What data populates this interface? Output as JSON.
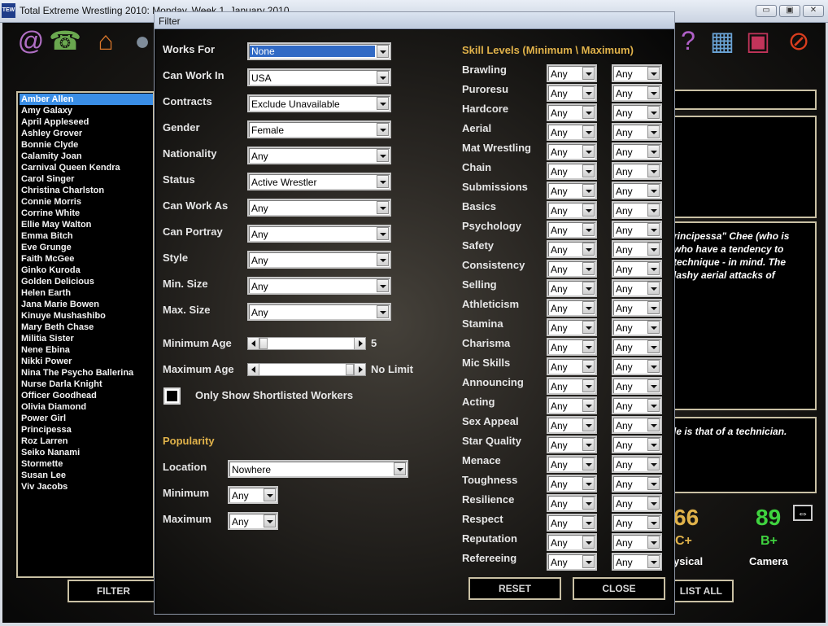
{
  "main_window": {
    "title": "Total Extreme Wrestling 2010: Monday, Week 1, January 2010",
    "app_icon": "TEW",
    "buttons": {
      "minimize": "▭",
      "maximize": "▣",
      "close": "✕"
    }
  },
  "toolbar_icons_left": [
    {
      "name": "at-icon",
      "glyph": "@",
      "color": "#b06fc4"
    },
    {
      "name": "phone-icon",
      "glyph": "☎",
      "color": "#6aa84f"
    },
    {
      "name": "home-icon",
      "glyph": "⌂",
      "color": "#d9772b"
    },
    {
      "name": "person-icon",
      "glyph": "●",
      "color": "#7f8c9a"
    }
  ],
  "toolbar_icons_right": [
    {
      "name": "help-icon",
      "glyph": "?",
      "color": "#b060c8"
    },
    {
      "name": "save-disk-icon",
      "glyph": "▦",
      "color": "#6aa3d5"
    },
    {
      "name": "floppy-icon",
      "glyph": "▣",
      "color": "#c2345a"
    },
    {
      "name": "stop-icon",
      "glyph": "⊘",
      "color": "#d93d1e"
    }
  ],
  "worker_list": {
    "selected": "Amber Allen",
    "items": [
      "Amber Allen",
      "Amy Galaxy",
      "April Appleseed",
      "Ashley Grover",
      "Bonnie Clyde",
      "Calamity Joan",
      "Carnival Queen Kendra",
      "Carol Singer",
      "Christina Charlston",
      "Connie Morris",
      "Corrine White",
      "Ellie May Walton",
      "Emma Bitch",
      "Eve Grunge",
      "Faith McGee",
      "Ginko Kuroda",
      "Golden Delicious",
      "Helen Earth",
      "Jana Marie Bowen",
      "Kinuye Mushashibo",
      "Mary Beth Chase",
      "Militia Sister",
      "Nene Ebina",
      "Nikki Power",
      "Nina The Psycho Ballerina",
      "Nurse Darla Knight",
      "Officer Goodhead",
      "Olivia Diamond",
      "Power Girl",
      "Principessa",
      "Roz Larren",
      "Seiko Nanami",
      "Stormette",
      "Susan Lee",
      "Viv Jacobs"
    ]
  },
  "bottom_buttons": {
    "filter": "FILTER",
    "list_all": "LIST ALL"
  },
  "right_panel": {
    "bio_lines": [
      "rincipessa\" Chee (who is",
      "who have a tendency to",
      " technique - in mind. The",
      "lashy aerial attacks of"
    ],
    "style_line": "le is that of a technician.",
    "stats": [
      {
        "value": "66",
        "grade": "C+",
        "label": "ysical",
        "color": "#e0b24a"
      },
      {
        "value": "89",
        "grade": "B+",
        "label": "Camera",
        "color": "#3fd33f"
      }
    ],
    "swap_icon": "⇔"
  },
  "filter_dialog": {
    "title": "Filter",
    "fields": [
      {
        "label": "Works For",
        "value": "None",
        "selected": true
      },
      {
        "label": "Can Work In",
        "value": "USA"
      },
      {
        "label": "Contracts",
        "value": "Exclude Unavailable"
      },
      {
        "label": "Gender",
        "value": "Female"
      },
      {
        "label": "Nationality",
        "value": "Any"
      },
      {
        "label": "Status",
        "value": "Active Wrestler"
      },
      {
        "label": "Can Work As",
        "value": "Any"
      },
      {
        "label": "Can Portray",
        "value": "Any"
      },
      {
        "label": "Style",
        "value": "Any"
      },
      {
        "label": "Min. Size",
        "value": "Any"
      },
      {
        "label": "Max. Size",
        "value": "Any"
      }
    ],
    "min_age": {
      "label": "Minimum Age",
      "value": "5",
      "slider_fraction": 0.0
    },
    "max_age": {
      "label": "Maximum Age",
      "value": "No Limit",
      "slider_fraction": 1.0
    },
    "shortlist": {
      "label": "Only Show Shortlisted Workers",
      "checked": false
    },
    "popularity": {
      "heading": "Popularity",
      "location_label": "Location",
      "location_value": "Nowhere",
      "minimum_label": "Minimum",
      "minimum_value": "Any",
      "maximum_label": "Maximum",
      "maximum_value": "Any"
    },
    "skills": {
      "heading": "Skill Levels (Minimum \\ Maximum)",
      "items": [
        {
          "label": "Brawling",
          "min": "Any",
          "max": "Any"
        },
        {
          "label": "Puroresu",
          "min": "Any",
          "max": "Any"
        },
        {
          "label": "Hardcore",
          "min": "Any",
          "max": "Any"
        },
        {
          "label": "Aerial",
          "min": "Any",
          "max": "Any"
        },
        {
          "label": "Mat Wrestling",
          "min": "Any",
          "max": "Any"
        },
        {
          "label": "Chain",
          "min": "Any",
          "max": "Any"
        },
        {
          "label": "Submissions",
          "min": "Any",
          "max": "Any"
        },
        {
          "label": "Basics",
          "min": "Any",
          "max": "Any"
        },
        {
          "label": "Psychology",
          "min": "Any",
          "max": "Any"
        },
        {
          "label": "Safety",
          "min": "Any",
          "max": "Any"
        },
        {
          "label": "Consistency",
          "min": "Any",
          "max": "Any"
        },
        {
          "label": "Selling",
          "min": "Any",
          "max": "Any"
        },
        {
          "label": "Athleticism",
          "min": "Any",
          "max": "Any"
        },
        {
          "label": "Stamina",
          "min": "Any",
          "max": "Any"
        },
        {
          "label": "Charisma",
          "min": "Any",
          "max": "Any"
        },
        {
          "label": "Mic Skills",
          "min": "Any",
          "max": "Any"
        },
        {
          "label": "Announcing",
          "min": "Any",
          "max": "Any"
        },
        {
          "label": "Acting",
          "min": "Any",
          "max": "Any"
        },
        {
          "label": "Sex Appeal",
          "min": "Any",
          "max": "Any"
        },
        {
          "label": "Star Quality",
          "min": "Any",
          "max": "Any"
        },
        {
          "label": "Menace",
          "min": "Any",
          "max": "Any"
        },
        {
          "label": "Toughness",
          "min": "Any",
          "max": "Any"
        },
        {
          "label": "Resilience",
          "min": "Any",
          "max": "Any"
        },
        {
          "label": "Respect",
          "min": "Any",
          "max": "Any"
        },
        {
          "label": "Reputation",
          "min": "Any",
          "max": "Any"
        },
        {
          "label": "Refereeing",
          "min": "Any",
          "max": "Any"
        }
      ]
    },
    "buttons": {
      "reset": "RESET",
      "close": "CLOSE"
    }
  }
}
